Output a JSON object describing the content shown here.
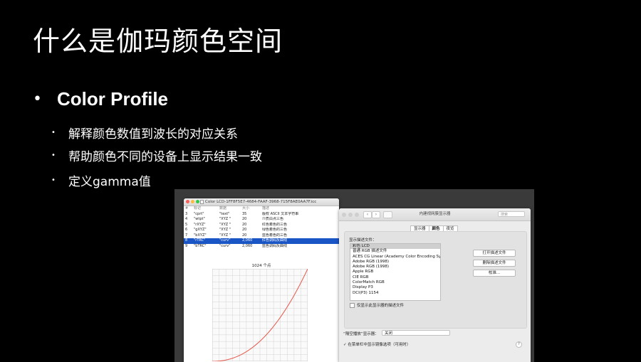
{
  "slide": {
    "title": "什么是伽玛颜色空间",
    "bullet_main": "Color Profile",
    "bullet_char": "•",
    "sub_bullets": [
      "解释颜色数值到波长的对应关系",
      "帮助颜色不同的设备上显示结果一致",
      "定义gamma值"
    ]
  },
  "colorsync_window": {
    "title": "Color LCD-1FF8F5E7-4684-FAAF-3968-715F8AE0AA7F.icc",
    "columns": [
      "#",
      "标记",
      "数据",
      "大小",
      "描述"
    ],
    "rows": [
      [
        "3",
        "\"cprt\"",
        "\"text\"",
        "35",
        "版权 ASCII 文本字符串"
      ],
      [
        "4",
        "\"wtpt\"",
        "\"XYZ \"",
        "20",
        "介质白点三色"
      ],
      [
        "5",
        "\"rXYZ\"",
        "\"XYZ \"",
        "20",
        "红色着色的三色"
      ],
      [
        "6",
        "\"gXYZ\"",
        "\"XYZ \"",
        "20",
        "绿色着色的三色"
      ],
      [
        "7",
        "\"bXYZ\"",
        "\"XYZ \"",
        "20",
        "蓝色着色的三色"
      ],
      [
        "8",
        "\"rTRC\"",
        "\"curv\"",
        "2,060",
        "红色调码反曲线"
      ],
      [
        "9",
        "\"bTRC\"",
        "\"curv\"",
        "2,060",
        "蓝色调码反曲线"
      ]
    ],
    "selected_row": 5,
    "plot_label": "1024 个点",
    "curve": {
      "type": "line",
      "gamma": 2.2,
      "x": [
        0,
        0.125,
        0.25,
        0.375,
        0.5,
        0.625,
        0.75,
        0.875,
        1
      ],
      "y": [
        0,
        0.01,
        0.047,
        0.116,
        0.218,
        0.355,
        0.531,
        0.746,
        1
      ]
    }
  },
  "display_window": {
    "title": "内建视网膜显示器",
    "search_placeholder": "搜索",
    "nav_back": "‹",
    "nav_forward": "›",
    "tabs": [
      "显示器",
      "颜色",
      "夜览"
    ],
    "active_tab": 1,
    "profile_label": "显示描述文件：",
    "profiles": [
      "彩色 LCD",
      "普通 RGB 描述文件",
      "ACES CG Linear (Academy Color Encoding Sy...",
      "Adobe RGB (1998)",
      "Adobe RGB (1998)",
      "Apple RGB",
      "CIE RGB",
      "ColorMatch RGB",
      "Display P3",
      "DCI(P3) 1154"
    ],
    "selected_profile": 0,
    "buttons": [
      "打开描述文件",
      "删除描述文件",
      "校准..."
    ],
    "show_only_label": "仅显示此显示器的描述文件",
    "airplay_label": "“隔空播放”显示器：",
    "airplay_value": "关闭",
    "mirror_label": "✓ 在菜单栏中显示镜像选项（可用时）",
    "help": "?"
  },
  "colors": {
    "background": "#000000",
    "text": "#ffffff",
    "selection_blue": "#1a55c6",
    "curve_red": "#e8574a"
  }
}
